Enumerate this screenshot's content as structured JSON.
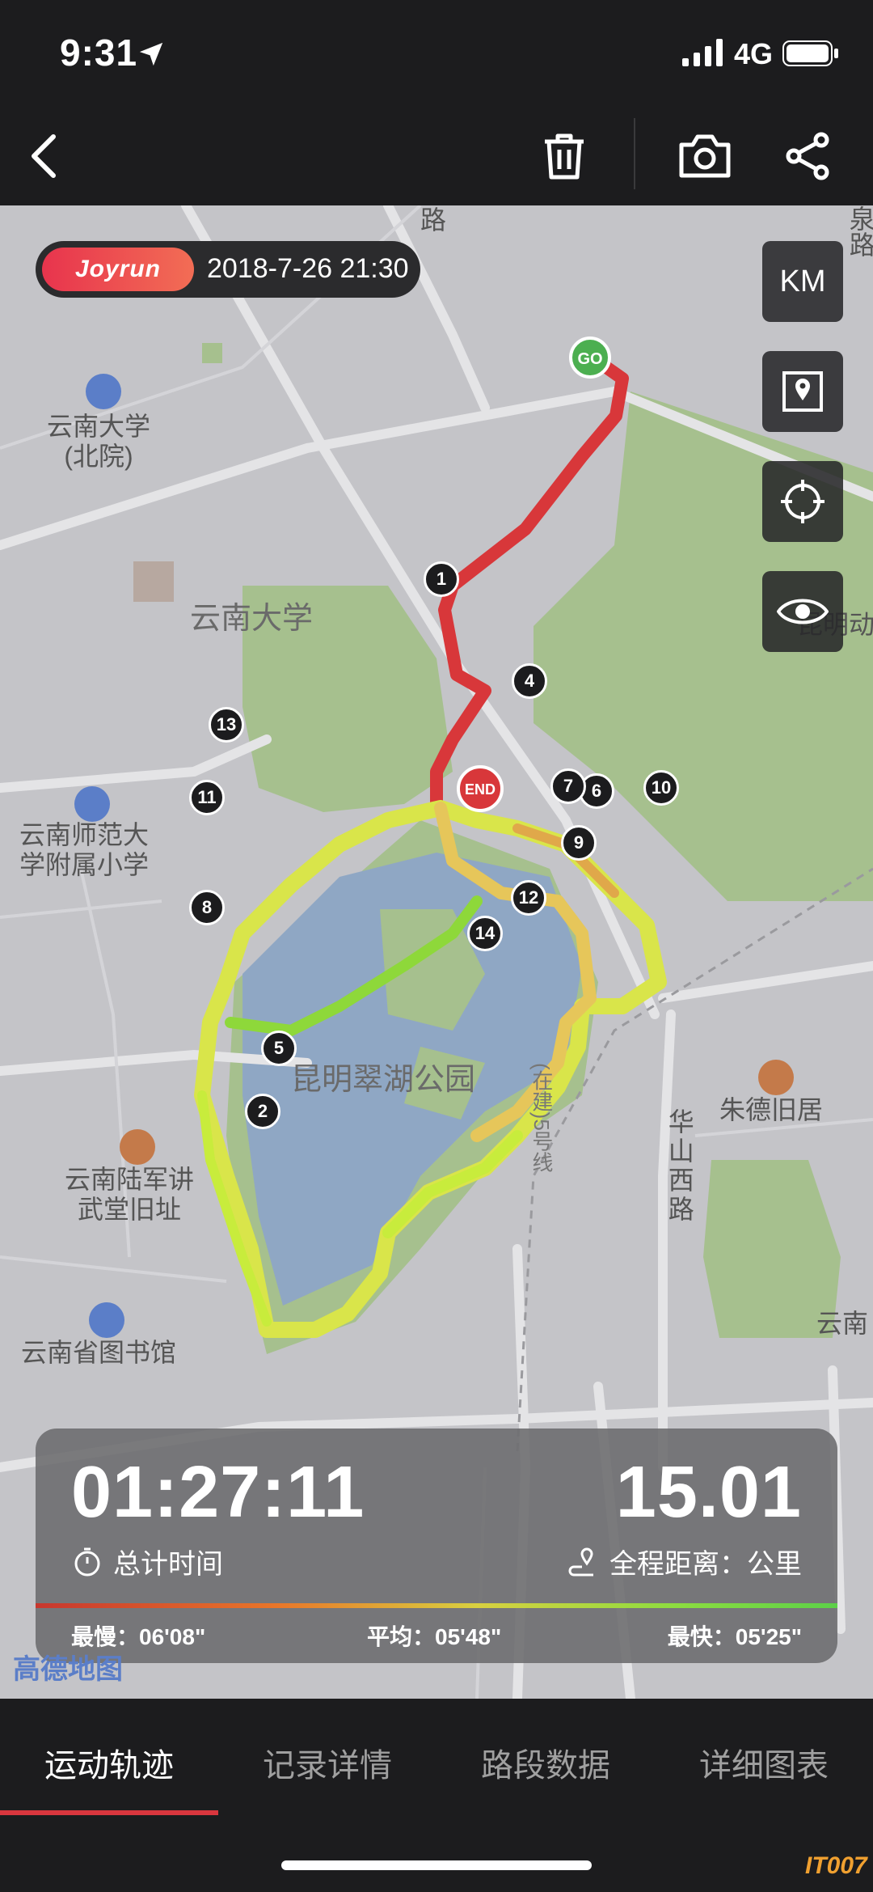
{
  "status_bar": {
    "time": "9:31",
    "network": "4G"
  },
  "nav": {
    "back_icon": "chevron-left-icon",
    "delete_icon": "trash-icon",
    "camera_icon": "camera-icon",
    "share_icon": "share-icon"
  },
  "map": {
    "brand": "Joyrun",
    "date": "2018-7-26 21:30",
    "unit_button": "KM",
    "start_marker": "GO",
    "end_marker": "END",
    "km_markers": [
      "1",
      "2",
      "4",
      "5",
      "6",
      "7",
      "8",
      "9",
      "10",
      "11",
      "12",
      "13",
      "14"
    ],
    "labels": {
      "yunnan_univ_north": "云南大学\n(北院)",
      "yunnan_univ": "云南大学",
      "normal_school": "云南师范大\n学附属小学",
      "military_academy": "云南陆军讲\n武堂旧址",
      "library": "云南省图书馆",
      "cuihu_park": "昆明翠湖公园",
      "zhude_residence": "朱德旧居",
      "huashan_road": "华山西路",
      "metro_line": "(在建)5号线",
      "road_top": "路",
      "edge_right_top": "泉路",
      "edge_right_mid": "昆明动",
      "edge_right_bottom": "云南"
    },
    "logo": "高德地图",
    "colors": {
      "slow": "#d8373a",
      "mid": "#e0b84a",
      "fast": "#c8ec3c",
      "water": "#8fa7c4",
      "green": "#9fbe88"
    }
  },
  "stats": {
    "duration": "01:27:11",
    "duration_label": "总计时间",
    "distance": "15.01",
    "distance_label": "全程距离：公里",
    "slowest": "最慢：06'08\"",
    "average": "平均：05'48\"",
    "fastest": "最快：05'25\""
  },
  "tabs": [
    {
      "label": "运动轨迹",
      "active": true
    },
    {
      "label": "记录详情",
      "active": false
    },
    {
      "label": "路段数据",
      "active": false
    },
    {
      "label": "详细图表",
      "active": false
    }
  ],
  "watermark": "IT007"
}
